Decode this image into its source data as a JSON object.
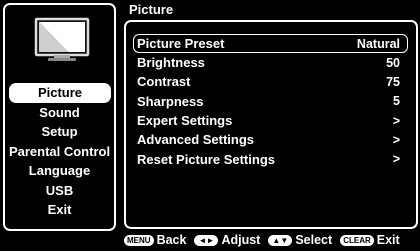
{
  "screen": {
    "title": "Picture"
  },
  "sidebar": {
    "icon": "tv-icon",
    "items": [
      {
        "label": "Picture",
        "active": true
      },
      {
        "label": "Sound"
      },
      {
        "label": "Setup"
      },
      {
        "label": "Parental Control"
      },
      {
        "label": "Language"
      },
      {
        "label": "USB"
      },
      {
        "label": "Exit"
      }
    ]
  },
  "settings": [
    {
      "label": "Picture Preset",
      "value": "Natural",
      "selected": true
    },
    {
      "label": "Brightness",
      "value": "50"
    },
    {
      "label": "Contrast",
      "value": "75"
    },
    {
      "label": "Sharpness",
      "value": "5"
    },
    {
      "label": "Expert Settings",
      "value": ">"
    },
    {
      "label": "Advanced Settings",
      "value": ">"
    },
    {
      "label": "Reset Picture Settings",
      "value": ">"
    }
  ],
  "footer": {
    "back_key": "MENU",
    "back_label": "Back",
    "adjust_key": "◄►",
    "adjust_label": "Adjust",
    "select_key": "▲▼",
    "select_label": "Select",
    "exit_key": "CLEAR",
    "exit_label": "Exit"
  }
}
